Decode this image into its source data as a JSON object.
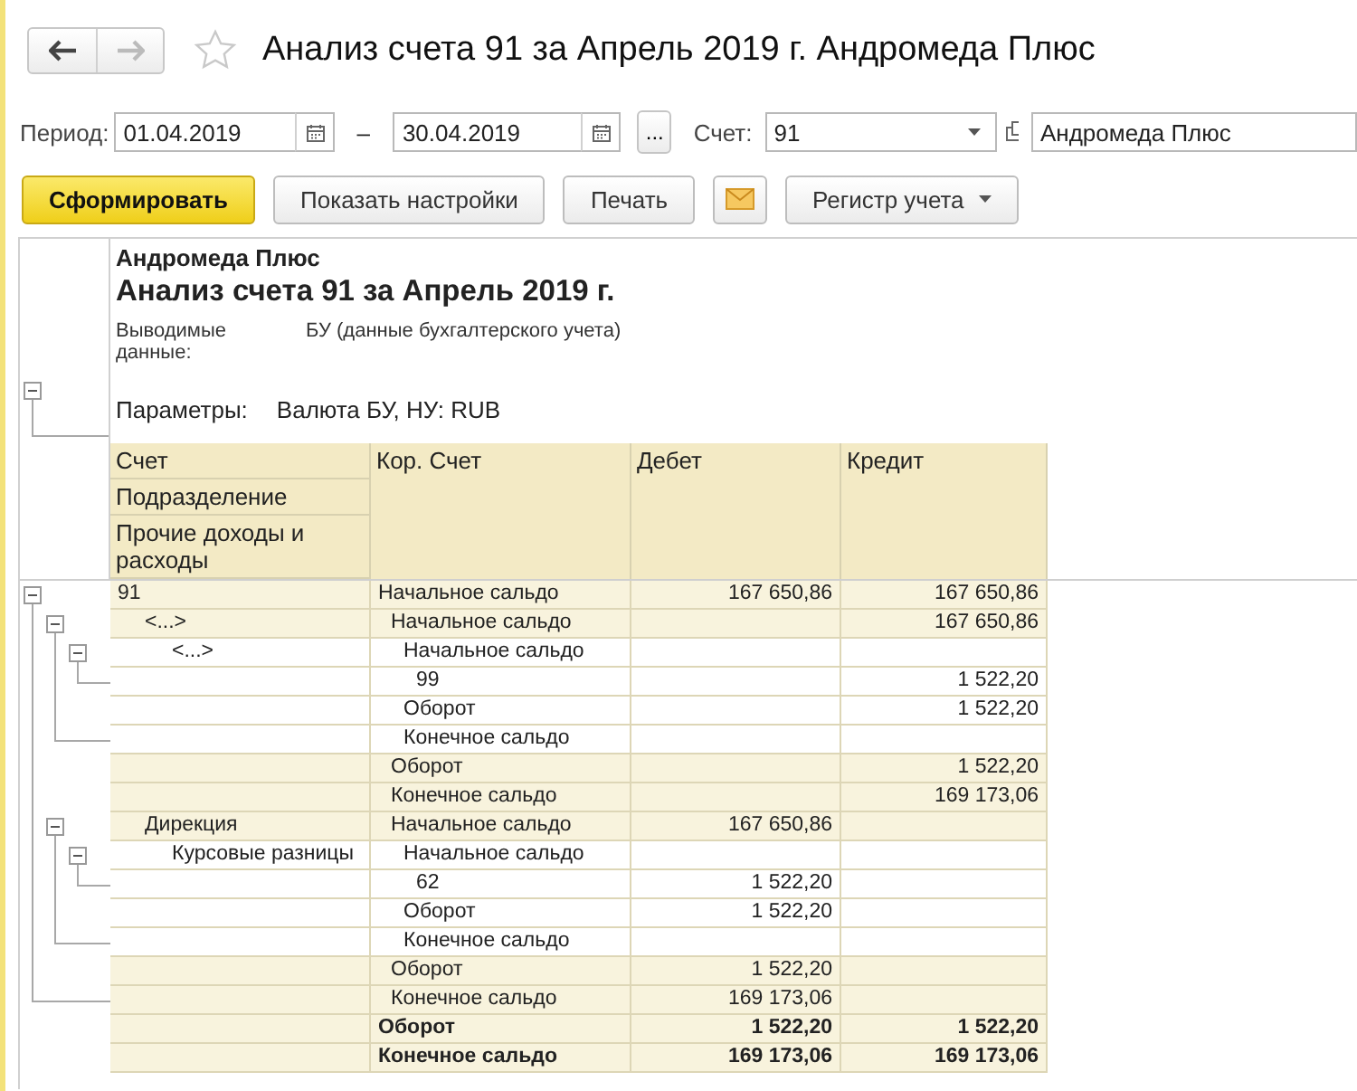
{
  "nav": {
    "back_disabled": false,
    "forward_disabled": true
  },
  "favorite": false,
  "title": "Анализ счета 91 за Апрель 2019 г. Андромеда Плюс",
  "filters": {
    "period_label": "Период:",
    "from": "01.04.2019",
    "dash": "–",
    "to": "30.04.2019",
    "more": "...",
    "account_label": "Счет:",
    "account": "91",
    "org": "Андромеда Плюс"
  },
  "toolbar": [
    {
      "kind": "primary",
      "label": "Сформировать"
    },
    {
      "kind": "default",
      "label": "Показать настройки"
    },
    {
      "kind": "default",
      "label": "Печать"
    },
    {
      "kind": "mail"
    },
    {
      "kind": "menu",
      "label": "Регистр учета"
    }
  ],
  "report": {
    "expanded": true,
    "org": "Андромеда Плюс",
    "heading": "Анализ счета 91 за Апрель 2019 г.",
    "output_label": "Выводимые данные:",
    "output_value": "БУ (данные бухгалтерского учета)",
    "params_label": "Параметры:",
    "params_value": "Валюта БУ, НУ: RUB",
    "columns": {
      "account": [
        "Счет",
        "Подразделение",
        "Прочие доходы и расходы"
      ],
      "kor": "Кор. Счет",
      "debit": "Дебет",
      "credit": "Кредит"
    },
    "rows": [
      {
        "account": "91",
        "kor": "Начальное сальдо",
        "debit": "167 650,86",
        "credit": "167 650,86",
        "expanded": true,
        "children": [
          {
            "account": "<...>",
            "kor": "Начальное сальдо",
            "credit": "167 650,86",
            "expanded": true,
            "children": [
              {
                "account": "<...>",
                "kor": "Начальное сальдо",
                "expanded": true,
                "children": [
                  {
                    "kor": "99",
                    "credit": "1 522,20"
                  }
                ],
                "footer": [
                  {
                    "kor": "Оборот",
                    "credit": "1 522,20"
                  },
                  {
                    "kor": "Конечное сальдо"
                  }
                ]
              }
            ],
            "footer": [
              {
                "kor": "Оборот",
                "credit": "1 522,20"
              },
              {
                "kor": "Конечное сальдо",
                "credit": "169 173,06"
              }
            ]
          },
          {
            "account": "Дирекция",
            "kor": "Начальное сальдо",
            "debit": "167 650,86",
            "expanded": true,
            "children": [
              {
                "account": "Курсовые разницы",
                "kor": "Начальное сальдо",
                "expanded": true,
                "children": [
                  {
                    "kor": "62",
                    "debit": "1 522,20"
                  }
                ],
                "footer": [
                  {
                    "kor": "Оборот",
                    "debit": "1 522,20"
                  },
                  {
                    "kor": "Конечное сальдо"
                  }
                ]
              }
            ],
            "footer": [
              {
                "kor": "Оборот",
                "debit": "1 522,20"
              },
              {
                "kor": "Конечное сальдо",
                "debit": "169 173,06"
              }
            ]
          }
        ],
        "footer": [
          {
            "kor": "Оборот",
            "debit": "1 522,20",
            "credit": "1 522,20"
          },
          {
            "kor": "Конечное сальдо",
            "debit": "169 173,06",
            "credit": "169 173,06"
          }
        ]
      }
    ]
  }
}
